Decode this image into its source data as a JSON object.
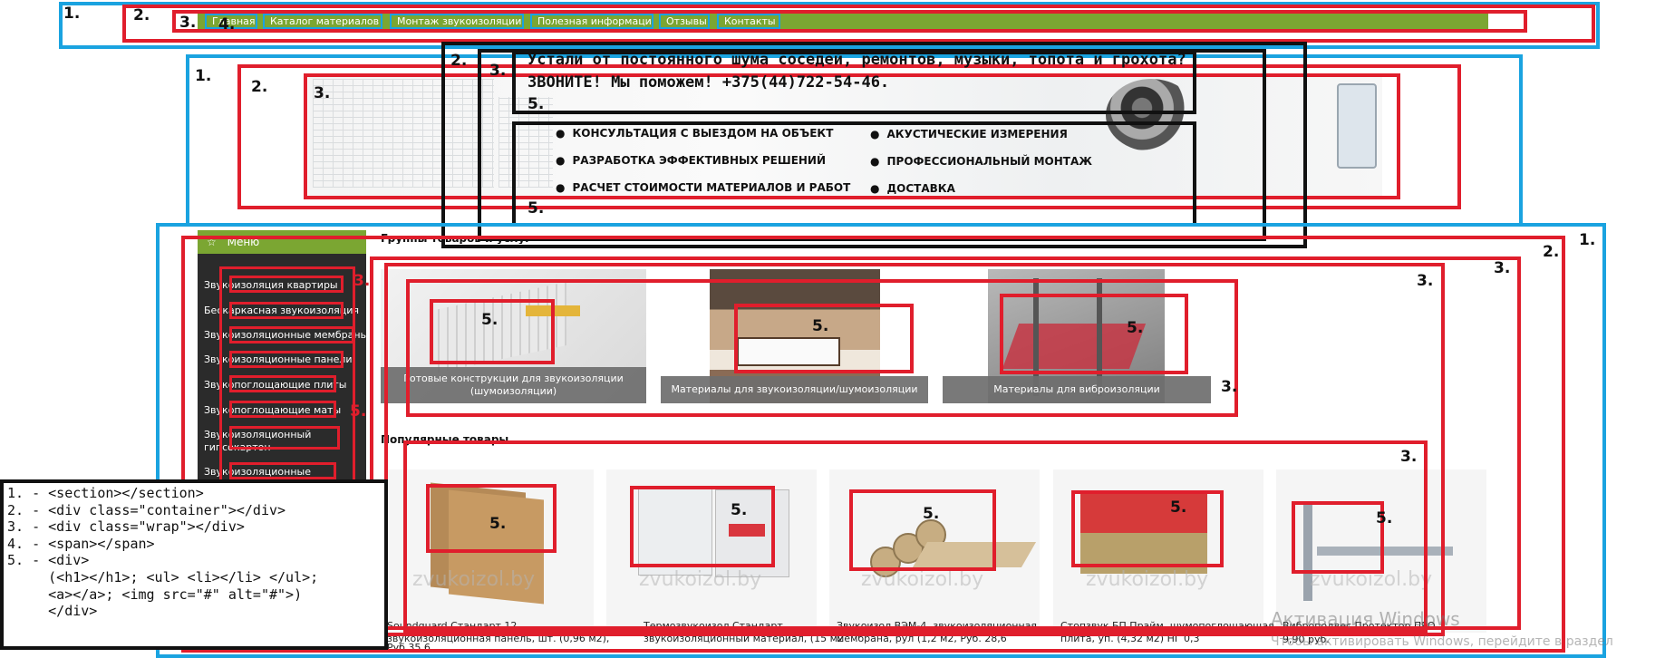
{
  "nav": {
    "items": [
      {
        "label": "Главная",
        "chevron": false
      },
      {
        "label": "Каталог материалов",
        "chevron": true
      },
      {
        "label": "Монтаж звукоизоляции",
        "chevron": true
      },
      {
        "label": "Полезная информация",
        "chevron": false
      },
      {
        "label": "Отзывы",
        "chevron": false
      },
      {
        "label": "Контакты",
        "chevron": false
      }
    ]
  },
  "banner": {
    "headline1": "Устали от постоянного шума соседей, ремонтов, музыки, топота и грохота?",
    "headline2": "ЗВОНИТЕ! Мы поможем! +375(44)722-54-46.",
    "services": [
      "КОНСУЛЬТАЦИЯ С ВЫЕЗДОМ НА ОБЪЕКТ",
      "РАЗРАБОТКА ЭФФЕКТИВНЫХ РЕШЕНИЙ",
      "РАСЧЕТ СТОИМОСТИ МАТЕРИАЛОВ И РАБОТ",
      "АКУСТИЧЕСКИЕ ИЗМЕРЕНИЯ",
      "ПРОФЕССИОНАЛЬНЫЙ МОНТАЖ",
      "ДОСТАВКА"
    ]
  },
  "sidebar": {
    "title": "Меню",
    "items": [
      "Звукоизоляция квартиры",
      "Бескаркасная звукоизоляция",
      "Звукоизоляционные мембраны",
      "Звукоизоляционные панели",
      "Звукопоглощающие плиты",
      "Звукопоглощающие маты",
      "Звукоизоляционный",
      "гипсокартон",
      "Звукоизоляционные"
    ]
  },
  "groups": {
    "title": "Группы товаров и услуг",
    "items": [
      {
        "caption": "Готовые конструкции для звукоизоляции (шумоизоляции)"
      },
      {
        "caption": "Материалы для звукоизоляции/шумоизоляции"
      },
      {
        "caption": "Материалы для виброизоляции"
      }
    ]
  },
  "popular": {
    "title": "Популярные товары",
    "watermark": "zvukoizol.by",
    "items": [
      {
        "name": "Soundguard Стандарт 12,",
        "line2": "звукоизоляционная панель, шт. (0,96 м2),",
        "price": "Руб.35,6"
      },
      {
        "name": "Термозвукоизол Стандарт,",
        "line2": "звукоизоляционный материал, (15 м2",
        "price": ""
      },
      {
        "name": "Звукоизол ВЭМ-4, звукоизоляционная",
        "line2": "мембрана, рул (1,2 м2, Руб. 28,6",
        "price": ""
      },
      {
        "name": "Стопзвук БП Прайм, шумопоглощающая",
        "line2": "плита, уп. (4,32 м2) НГ 0,3",
        "price": ""
      },
      {
        "name": "Виброподвес Протектор ПРО",
        "line2": "",
        "price": "9,90 руб."
      }
    ]
  },
  "activation": {
    "line1": "Активация Windows",
    "line2": "Чтобы активировать Windows, перейдите в раздел"
  },
  "labels": {
    "n1": "1.",
    "n2": "2.",
    "n3": "3.",
    "n4": "4.",
    "n5": "5."
  },
  "legend": {
    "lines": [
      "1. - <section></section>",
      "2. - <div class=\"container\"></div>",
      "3. - <div class=\"wrap\"></div>",
      "4. - <span></span>",
      "5. - <div>",
      "     (<h1></h1>; <ul> <li></li> </ul>;",
      "     <a></a>; <img src=\"#\" alt=\"#\">)",
      "     </div>"
    ]
  },
  "colors": {
    "nav_green": "#7ba632",
    "section_blue": "#1aa3e0",
    "container_red": "#e01e2c",
    "sidebar_dark": "#2b2b2b"
  }
}
